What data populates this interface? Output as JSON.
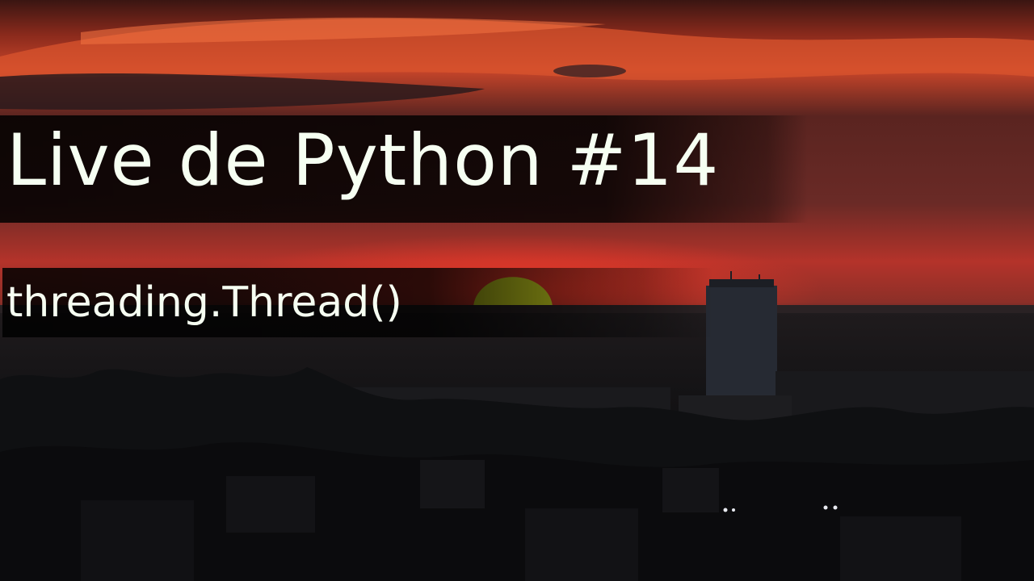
{
  "thumbnail": {
    "title": "Live de Python #14",
    "subtitle": "threading.Thread()"
  },
  "colors": {
    "sky_top": "#3a1512",
    "sky_glow": "#d8402c",
    "sun": "#d7e020",
    "city": "#0c0d0f",
    "text": "#f6fff2"
  }
}
